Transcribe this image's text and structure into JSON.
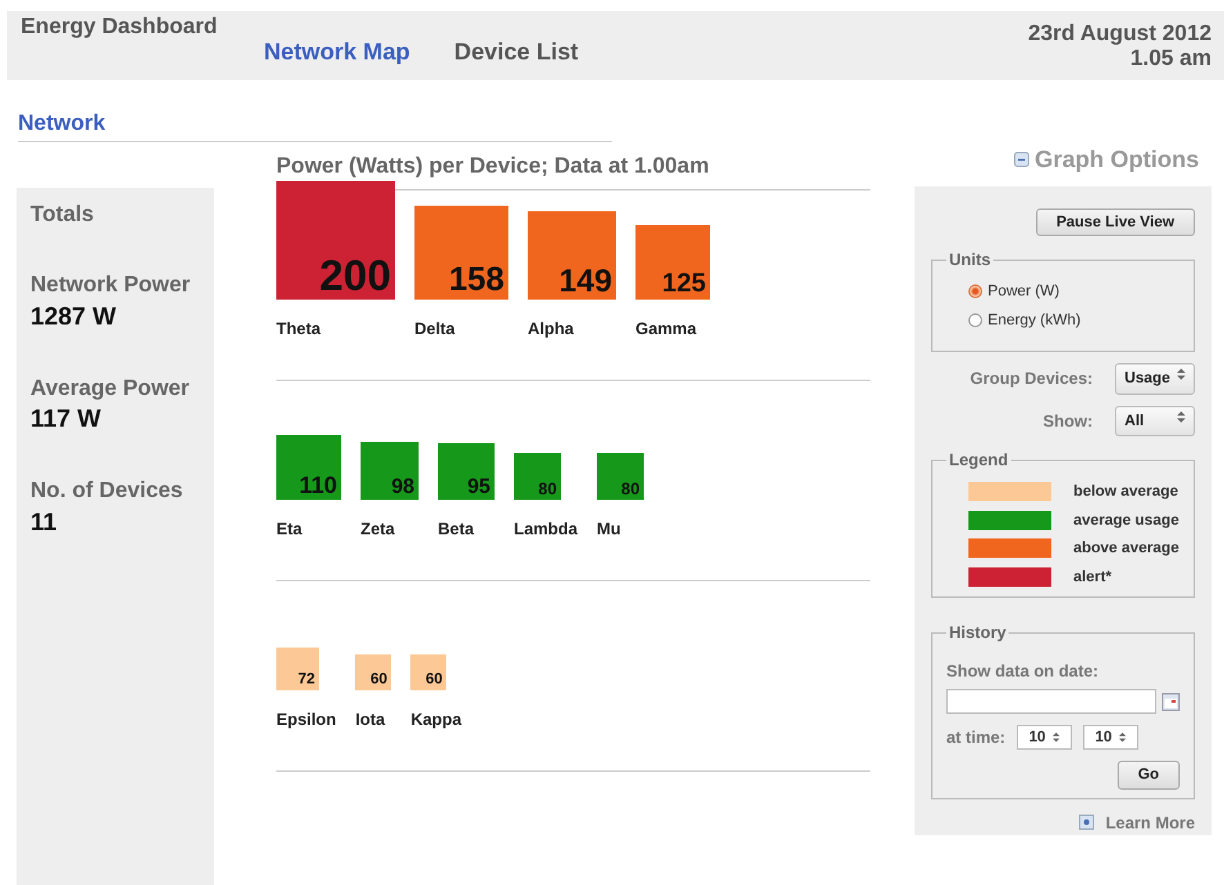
{
  "header": {
    "title": "Energy Dashboard",
    "nav": [
      {
        "label": "Network Map",
        "selected": true
      },
      {
        "label": "Device List",
        "selected": false
      }
    ],
    "date": "23rd August 2012",
    "time": "1.05 am"
  },
  "breadcrumb": "Network",
  "totals": {
    "heading": "Totals",
    "stats": [
      {
        "label": "Network Power",
        "value": "1287 W"
      },
      {
        "label": "Average Power",
        "value": "117 W"
      },
      {
        "label": "No. of Devices",
        "value": "11"
      }
    ]
  },
  "graph": {
    "title": "Power (Watts) per Device; Data at 1.00am",
    "groups": [
      {
        "devices": [
          {
            "name": "Theta",
            "value": "200",
            "color": "#cc2233"
          },
          {
            "name": "Delta",
            "value": "158",
            "color": "#f0661e"
          },
          {
            "name": "Alpha",
            "value": "149",
            "color": "#f0661e"
          },
          {
            "name": "Gamma",
            "value": "125",
            "color": "#f0661e"
          }
        ]
      },
      {
        "devices": [
          {
            "name": "Eta",
            "value": "110",
            "color": "#16991a"
          },
          {
            "name": "Zeta",
            "value": "98",
            "color": "#16991a"
          },
          {
            "name": "Beta",
            "value": "95",
            "color": "#16991a"
          },
          {
            "name": "Lambda",
            "value": "80",
            "color": "#16991a"
          },
          {
            "name": "Mu",
            "value": "80",
            "color": "#16991a"
          }
        ]
      },
      {
        "devices": [
          {
            "name": "Epsilon",
            "value": "72",
            "color": "#fcc896"
          },
          {
            "name": "Iota",
            "value": "60",
            "color": "#fcc896"
          },
          {
            "name": "Kappa",
            "value": "60",
            "color": "#fcc896"
          }
        ]
      }
    ]
  },
  "options": {
    "toggle": "Graph Options",
    "pause_button": "Pause Live View",
    "units": {
      "legend": "Units",
      "options": [
        {
          "label": "Power (W)",
          "selected": true
        },
        {
          "label": "Energy (kWh)",
          "selected": false
        }
      ]
    },
    "group_devices": {
      "label": "Group Devices:",
      "value": "Usage"
    },
    "show": {
      "label": "Show:",
      "value": "All"
    },
    "legend": {
      "legend": "Legend",
      "items": [
        {
          "label": "below average",
          "color": "#fcc896"
        },
        {
          "label": "average usage",
          "color": "#16991a"
        },
        {
          "label": "above average",
          "color": "#f0661e"
        },
        {
          "label": "alert*",
          "color": "#cc2233"
        }
      ]
    },
    "history": {
      "legend": "History",
      "date_label": "Show data on date:",
      "time_label": "at time:",
      "hour": "10",
      "minute": "10",
      "go_button": "Go"
    },
    "learn_more": "Learn More"
  }
}
